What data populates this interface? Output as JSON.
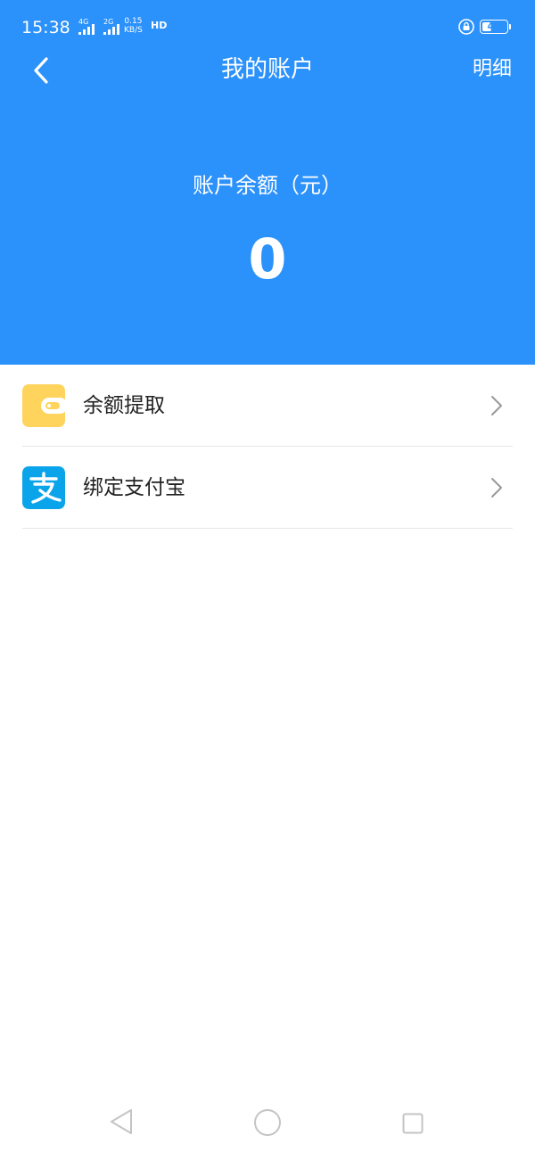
{
  "status_bar": {
    "time": "15:38",
    "signal_1_label": "4G",
    "signal_2_label": "2G",
    "net_speed_value": "0.15",
    "net_speed_unit": "KB/S",
    "hd_label": "HD",
    "battery_level": "40",
    "battery_percent": 40
  },
  "nav": {
    "back_icon": "chevron-left-icon",
    "title": "我的账户",
    "detail_label": "明细"
  },
  "balance": {
    "label": "账户余额（元）",
    "value": "0"
  },
  "menu": {
    "items": [
      {
        "label": "余额提取",
        "icon": "wallet-icon",
        "icon_color": "#ffd45c"
      },
      {
        "label": "绑定支付宝",
        "icon": "alipay-icon",
        "icon_color": "#0aa4ea"
      }
    ]
  },
  "colors": {
    "header_bg": "#2b91fb",
    "divider": "#e6e6e6",
    "text": "#222222"
  },
  "system_nav": {
    "back_icon": "triangle-back-icon",
    "home_icon": "circle-home-icon",
    "recent_icon": "square-recent-icon"
  }
}
